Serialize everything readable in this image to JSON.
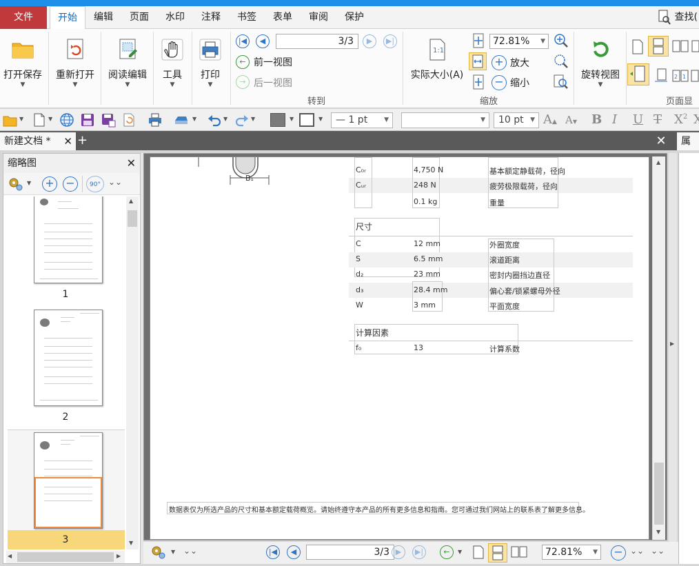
{
  "menu": {
    "file": "文件",
    "items": [
      "开始",
      "编辑",
      "页面",
      "水印",
      "注释",
      "书签",
      "表单",
      "审阅",
      "保护"
    ],
    "search": "查找("
  },
  "ribbon": {
    "open_save": "打开保存",
    "reopen": "重新打开",
    "read_edit": "阅读编辑",
    "tools": "工具",
    "print": "打印",
    "page_current": "3",
    "page_total": "/3",
    "prev_view": "前一视图",
    "next_view": "后一视图",
    "goto_label": "转到",
    "actual_size": "实际大小(A)",
    "zoom_value": "72.81%",
    "zoom_in": "放大",
    "zoom_out": "缩小",
    "zoom_label": "缩放",
    "rotate_view": "旋转视图",
    "page_display_label": "页面显示"
  },
  "quickbar": {
    "line_width": "— 1 pt",
    "font_name": "",
    "font_size": "10 pt"
  },
  "tabs": {
    "doc_title": "新建文档 *",
    "props": "属性"
  },
  "thumbnails": {
    "title": "缩略图",
    "rotate_label": "90°",
    "pages": [
      "1",
      "2",
      "3"
    ]
  },
  "doc": {
    "top_rows": [
      {
        "sym": "C₀ᵣ",
        "val": "4,750  N",
        "desc": "基本额定静载荷，径向"
      },
      {
        "sym": "Cᵤᵣ",
        "val": "248  N",
        "desc": "疲劳极限载荷，径向"
      },
      {
        "sym": "",
        "val": "0.1  kg",
        "desc": "重量"
      }
    ],
    "b1_label": "B₁",
    "dim_title": "尺寸",
    "dim_rows": [
      {
        "sym": "C",
        "val": "12  mm",
        "desc": "外圈宽度"
      },
      {
        "sym": "S",
        "val": "6.5  mm",
        "desc": "滚道距离"
      },
      {
        "sym": "d₂",
        "val": "23  mm",
        "desc": "密封内圈挡边直径"
      },
      {
        "sym": "d₃",
        "val": "28.4  mm",
        "desc": "偏心套/锁紧螺母外径"
      },
      {
        "sym": "W",
        "val": "3  mm",
        "desc": "平面宽度"
      }
    ],
    "calc_title": "计算因素",
    "calc_rows": [
      {
        "sym": "f₀",
        "val": "13",
        "desc": "计算系数"
      }
    ],
    "footer": "数据表仅为所选产品的尺寸和基本额定载荷概览。请始终遵守本产品的所有更多信息和指南。您可通过我们网站上的联系表了解更多信息。"
  },
  "status": {
    "page_current": "3",
    "page_total": "/3",
    "zoom_value": "72.81%"
  },
  "colors": {
    "accent": "#1e8fe8",
    "file_menu": "#c0393b",
    "highlight": "#f7d779"
  }
}
